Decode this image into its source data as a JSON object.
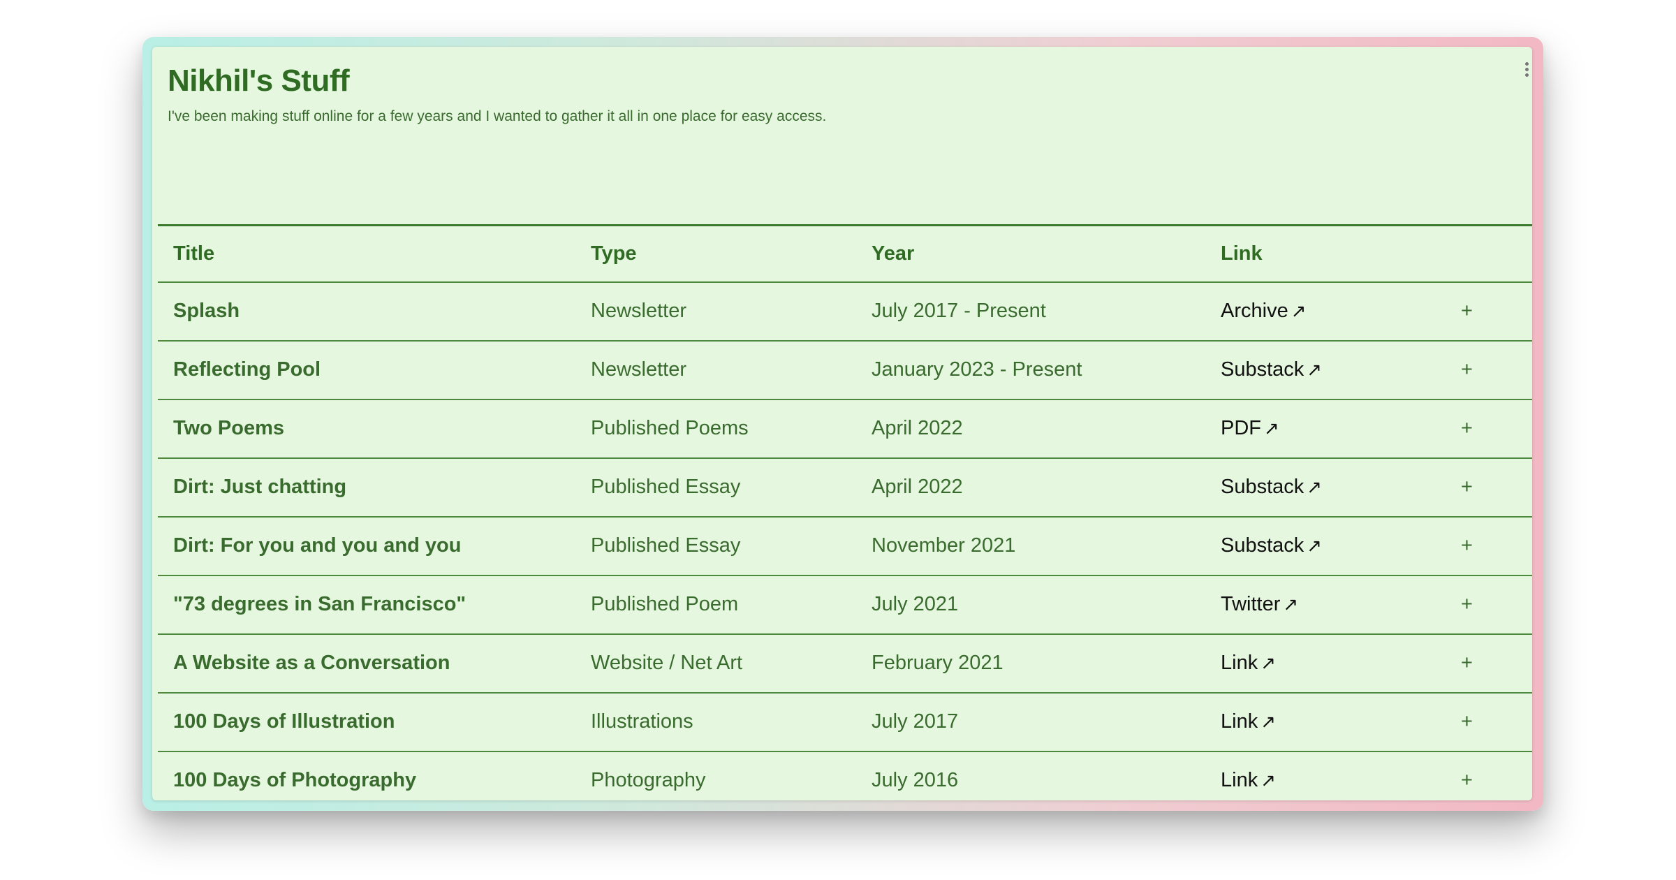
{
  "page": {
    "title": "Nikhil's Stuff",
    "description": "I've been making stuff online for a few years and I wanted to gather it all in one place for easy access."
  },
  "table": {
    "headers": {
      "title": "Title",
      "type": "Type",
      "year": "Year",
      "link": "Link"
    },
    "expand_symbol": "+",
    "link_arrow": "↗",
    "rows": [
      {
        "title": "Splash",
        "type": "Newsletter",
        "year": "July 2017 - Present",
        "link": "Archive"
      },
      {
        "title": "Reflecting Pool",
        "type": "Newsletter",
        "year": "January 2023 - Present",
        "link": "Substack"
      },
      {
        "title": "Two Poems",
        "type": "Published Poems",
        "year": "April 2022",
        "link": "PDF"
      },
      {
        "title": "Dirt: Just chatting",
        "type": "Published Essay",
        "year": "April 2022",
        "link": "Substack"
      },
      {
        "title": "Dirt: For you and you and you",
        "type": "Published Essay",
        "year": "November 2021",
        "link": "Substack"
      },
      {
        "title": "\"73 degrees in San Francisco\"",
        "type": "Published Poem",
        "year": "July 2021",
        "link": "Twitter"
      },
      {
        "title": "A Website as a Conversation",
        "type": "Website / Net Art",
        "year": "February 2021",
        "link": "Link"
      },
      {
        "title": "100 Days of Illustration",
        "type": "Illustrations",
        "year": "July 2017",
        "link": "Link"
      },
      {
        "title": "100 Days of Photography",
        "type": "Photography",
        "year": "July 2016",
        "link": "Link"
      }
    ]
  },
  "colors": {
    "panel_bg": "#e6f7e0",
    "accent_green": "#2f6b22",
    "frame_left": "#b9efe6",
    "frame_right": "#f2b8c3"
  }
}
